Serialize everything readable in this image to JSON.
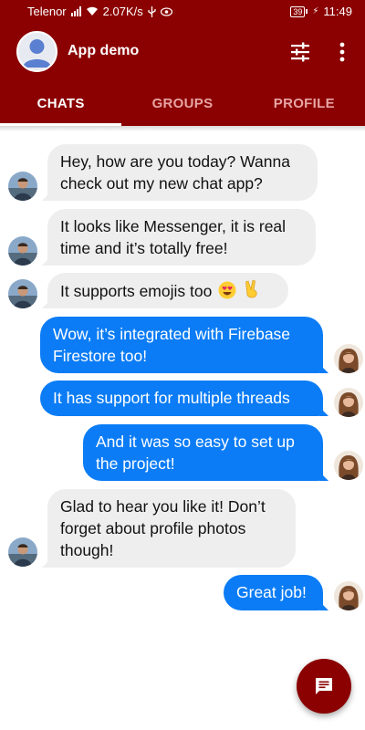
{
  "status_bar": {
    "carrier": "Telenor",
    "speed": "2.07K/s",
    "battery": "39",
    "time": "11:49"
  },
  "app_bar": {
    "title": "App demo",
    "icons": [
      "user-avatar-icon",
      "tune-icon",
      "more-vert-icon"
    ]
  },
  "tabs": [
    {
      "label": "CHATS",
      "active": true
    },
    {
      "label": "GROUPS",
      "active": false
    },
    {
      "label": "PROFILE",
      "active": false
    }
  ],
  "messages": [
    {
      "sender": "other",
      "text": "Hey, how are you today? Wanna check out my new chat app?"
    },
    {
      "sender": "other",
      "text": "It looks like Messenger, it is real time and it’s totally free!"
    },
    {
      "sender": "other",
      "text": "It supports emojis too",
      "emojis": [
        "heart-eyes-emoji",
        "victory-hand-emoji"
      ]
    },
    {
      "sender": "me",
      "text": "Wow, it’s integrated with Firebase Firestore too!"
    },
    {
      "sender": "me",
      "text": "It has support for multiple threads"
    },
    {
      "sender": "me",
      "text": "And it was so easy to set up the project!"
    },
    {
      "sender": "other",
      "text": "Glad to hear you like it! Don’t forget about profile photos though!"
    },
    {
      "sender": "me",
      "text": "Great job!"
    }
  ],
  "fab": {
    "icon": "message-icon"
  },
  "colors": {
    "primary": "#8b0000",
    "outgoing_bubble": "#0b7cf5",
    "incoming_bubble": "#eeeeee",
    "inactive_tab": "#e8a5a5"
  }
}
